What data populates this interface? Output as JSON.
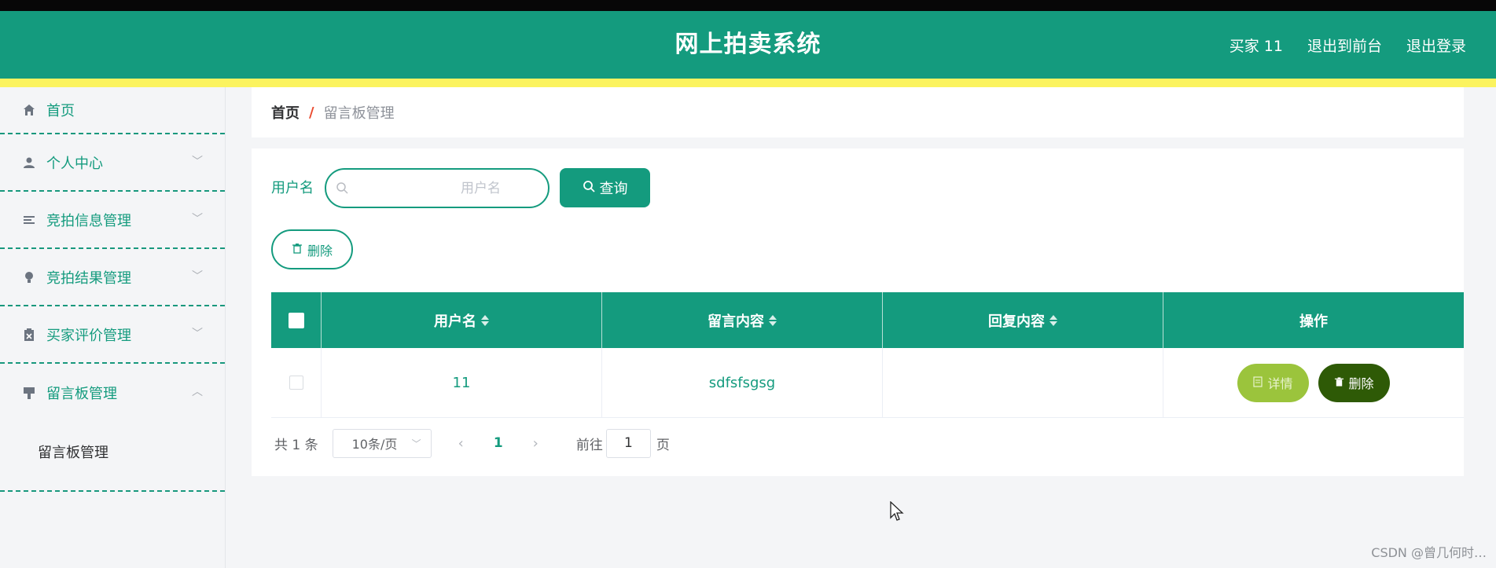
{
  "header": {
    "title": "网上拍卖系统",
    "user": "买家 11",
    "exit_front": "退出到前台",
    "logout": "退出登录"
  },
  "sidebar": {
    "items": [
      {
        "label": "首页",
        "icon": "home-icon"
      },
      {
        "label": "个人中心",
        "icon": "user-icon"
      },
      {
        "label": "竞拍信息管理",
        "icon": "list-icon"
      },
      {
        "label": "竞拍结果管理",
        "icon": "bulb-icon"
      },
      {
        "label": "买家评价管理",
        "icon": "clipboard-icon"
      },
      {
        "label": "留言板管理",
        "icon": "board-icon"
      }
    ],
    "sub_item": "留言板管理"
  },
  "breadcrumb": {
    "home": "首页",
    "sep": "/",
    "current": "留言板管理"
  },
  "search": {
    "label": "用户名",
    "placeholder": "用户名",
    "button": "查询"
  },
  "actions": {
    "delete": "删除"
  },
  "table": {
    "headers": [
      "用户名",
      "留言内容",
      "回复内容",
      "操作"
    ],
    "rows": [
      {
        "username": "11",
        "content": "sdfsfsgsg",
        "reply": "",
        "detail": "详情",
        "delete": "删除"
      }
    ]
  },
  "pagination": {
    "total": "共 1 条",
    "page_size": "10条/页",
    "current_page": "1",
    "goto_label": "前往",
    "goto_value": "1",
    "unit": "页"
  },
  "watermark": "CSDN @曾几何时…",
  "colors": {
    "primary": "#149b7e",
    "stripe": "#fbf35f",
    "detail": "#9bc43c",
    "danger": "#2e5a06"
  }
}
